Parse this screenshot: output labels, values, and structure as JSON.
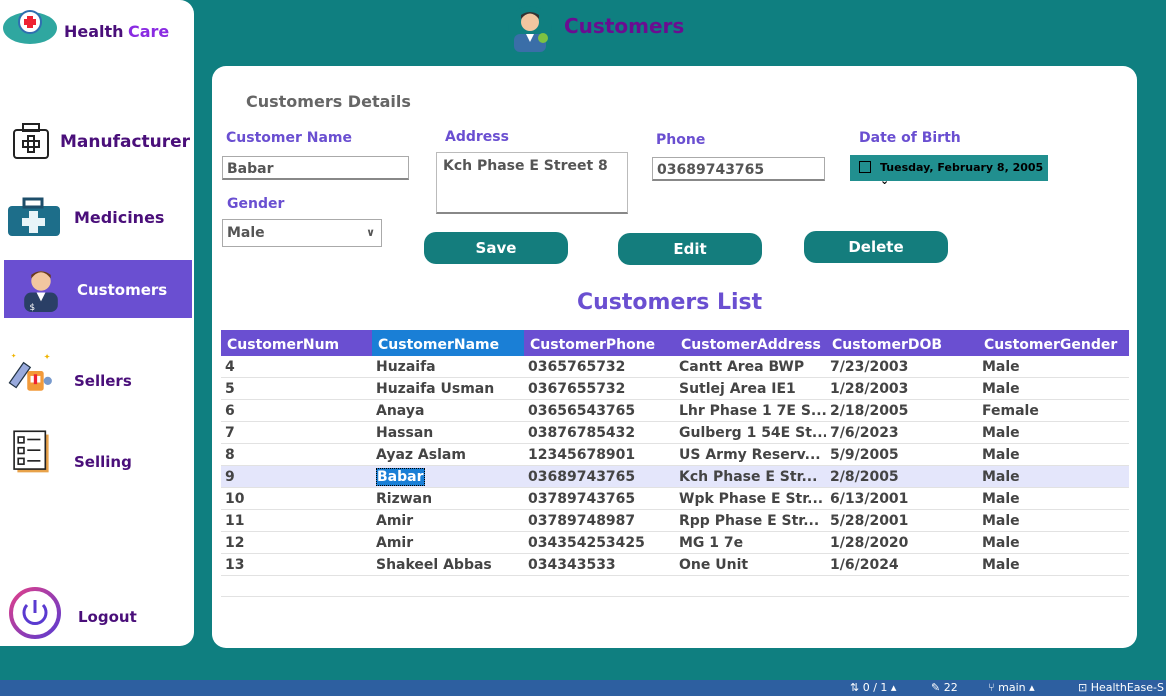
{
  "app": {
    "brand_word1": "Health",
    "brand_word2": "Care"
  },
  "header": {
    "title": "Customers"
  },
  "sidebar": {
    "items": [
      {
        "label": "Manufacturer",
        "icon": "first-aid-kit-icon"
      },
      {
        "label": "Medicines",
        "icon": "medical-bag-icon"
      },
      {
        "label": "Customers",
        "icon": "customer-avatar-icon",
        "active": true
      },
      {
        "label": "Sellers",
        "icon": "syringe-pills-icon"
      },
      {
        "label": "Selling",
        "icon": "checklist-icon"
      }
    ],
    "logout_label": "Logout"
  },
  "form": {
    "section_title": "Customers Details",
    "name_label": "Customer Name",
    "name_value": "Babar",
    "address_label": "Address",
    "address_value": "Kch Phase E Street 8",
    "phone_label": "Phone",
    "phone_value": "03689743765",
    "dob_label": "Date of Birth",
    "dob_value": "Tuesday, February 8, 2005",
    "gender_label": "Gender",
    "gender_value": "Male"
  },
  "buttons": {
    "save": "Save",
    "edit": "Edit",
    "delete": "Delete"
  },
  "list": {
    "title": "Customers List",
    "columns": [
      "CustomerNum",
      "CustomerName",
      "CustomerPhone",
      "CustomerAddress",
      "CustomerDOB",
      "CustomerGender"
    ],
    "rows": [
      [
        "4",
        "Huzaifa",
        "0365765732",
        "Cantt Area BWP",
        "7/23/2003",
        "Male"
      ],
      [
        "5",
        "Huzaifa Usman",
        "0367655732",
        "Sutlej Area IE1",
        "1/28/2003",
        "Male"
      ],
      [
        "6",
        "Anaya",
        "03656543765",
        "Lhr Phase 1 7E S...",
        "2/18/2005",
        "Female"
      ],
      [
        "7",
        "Hassan",
        "03876785432",
        "Gulberg 1 54E St...",
        "7/6/2023",
        "Male"
      ],
      [
        "8",
        "Ayaz Aslam",
        "12345678901",
        "US Army Reserv...",
        "5/9/2005",
        "Male"
      ],
      [
        "9",
        "Babar",
        "03689743765",
        "Kch Phase E Str...",
        "2/8/2005",
        "Male"
      ],
      [
        "10",
        "Rizwan",
        "03789743765",
        "Wpk Phase E Str...",
        "6/13/2001",
        "Male"
      ],
      [
        "11",
        "Amir",
        "03789748987",
        "Rpp Phase E Str...",
        "5/28/2001",
        "Male"
      ],
      [
        "12",
        "Amir",
        "034354253425",
        "MG 1 7e",
        "1/28/2020",
        "Male"
      ],
      [
        "13",
        "Shakeel Abbas",
        "034343533",
        "One Unit",
        "1/6/2024",
        "Male"
      ]
    ],
    "selected_row": 5
  },
  "statusbar": {
    "position": "0 / 1",
    "changes": "22",
    "branch": "main",
    "repo": "HealthEase-S"
  },
  "colors": {
    "teal": "#0f7f80",
    "purple": "#6a4fd1",
    "selection": "#1a7fd6"
  }
}
